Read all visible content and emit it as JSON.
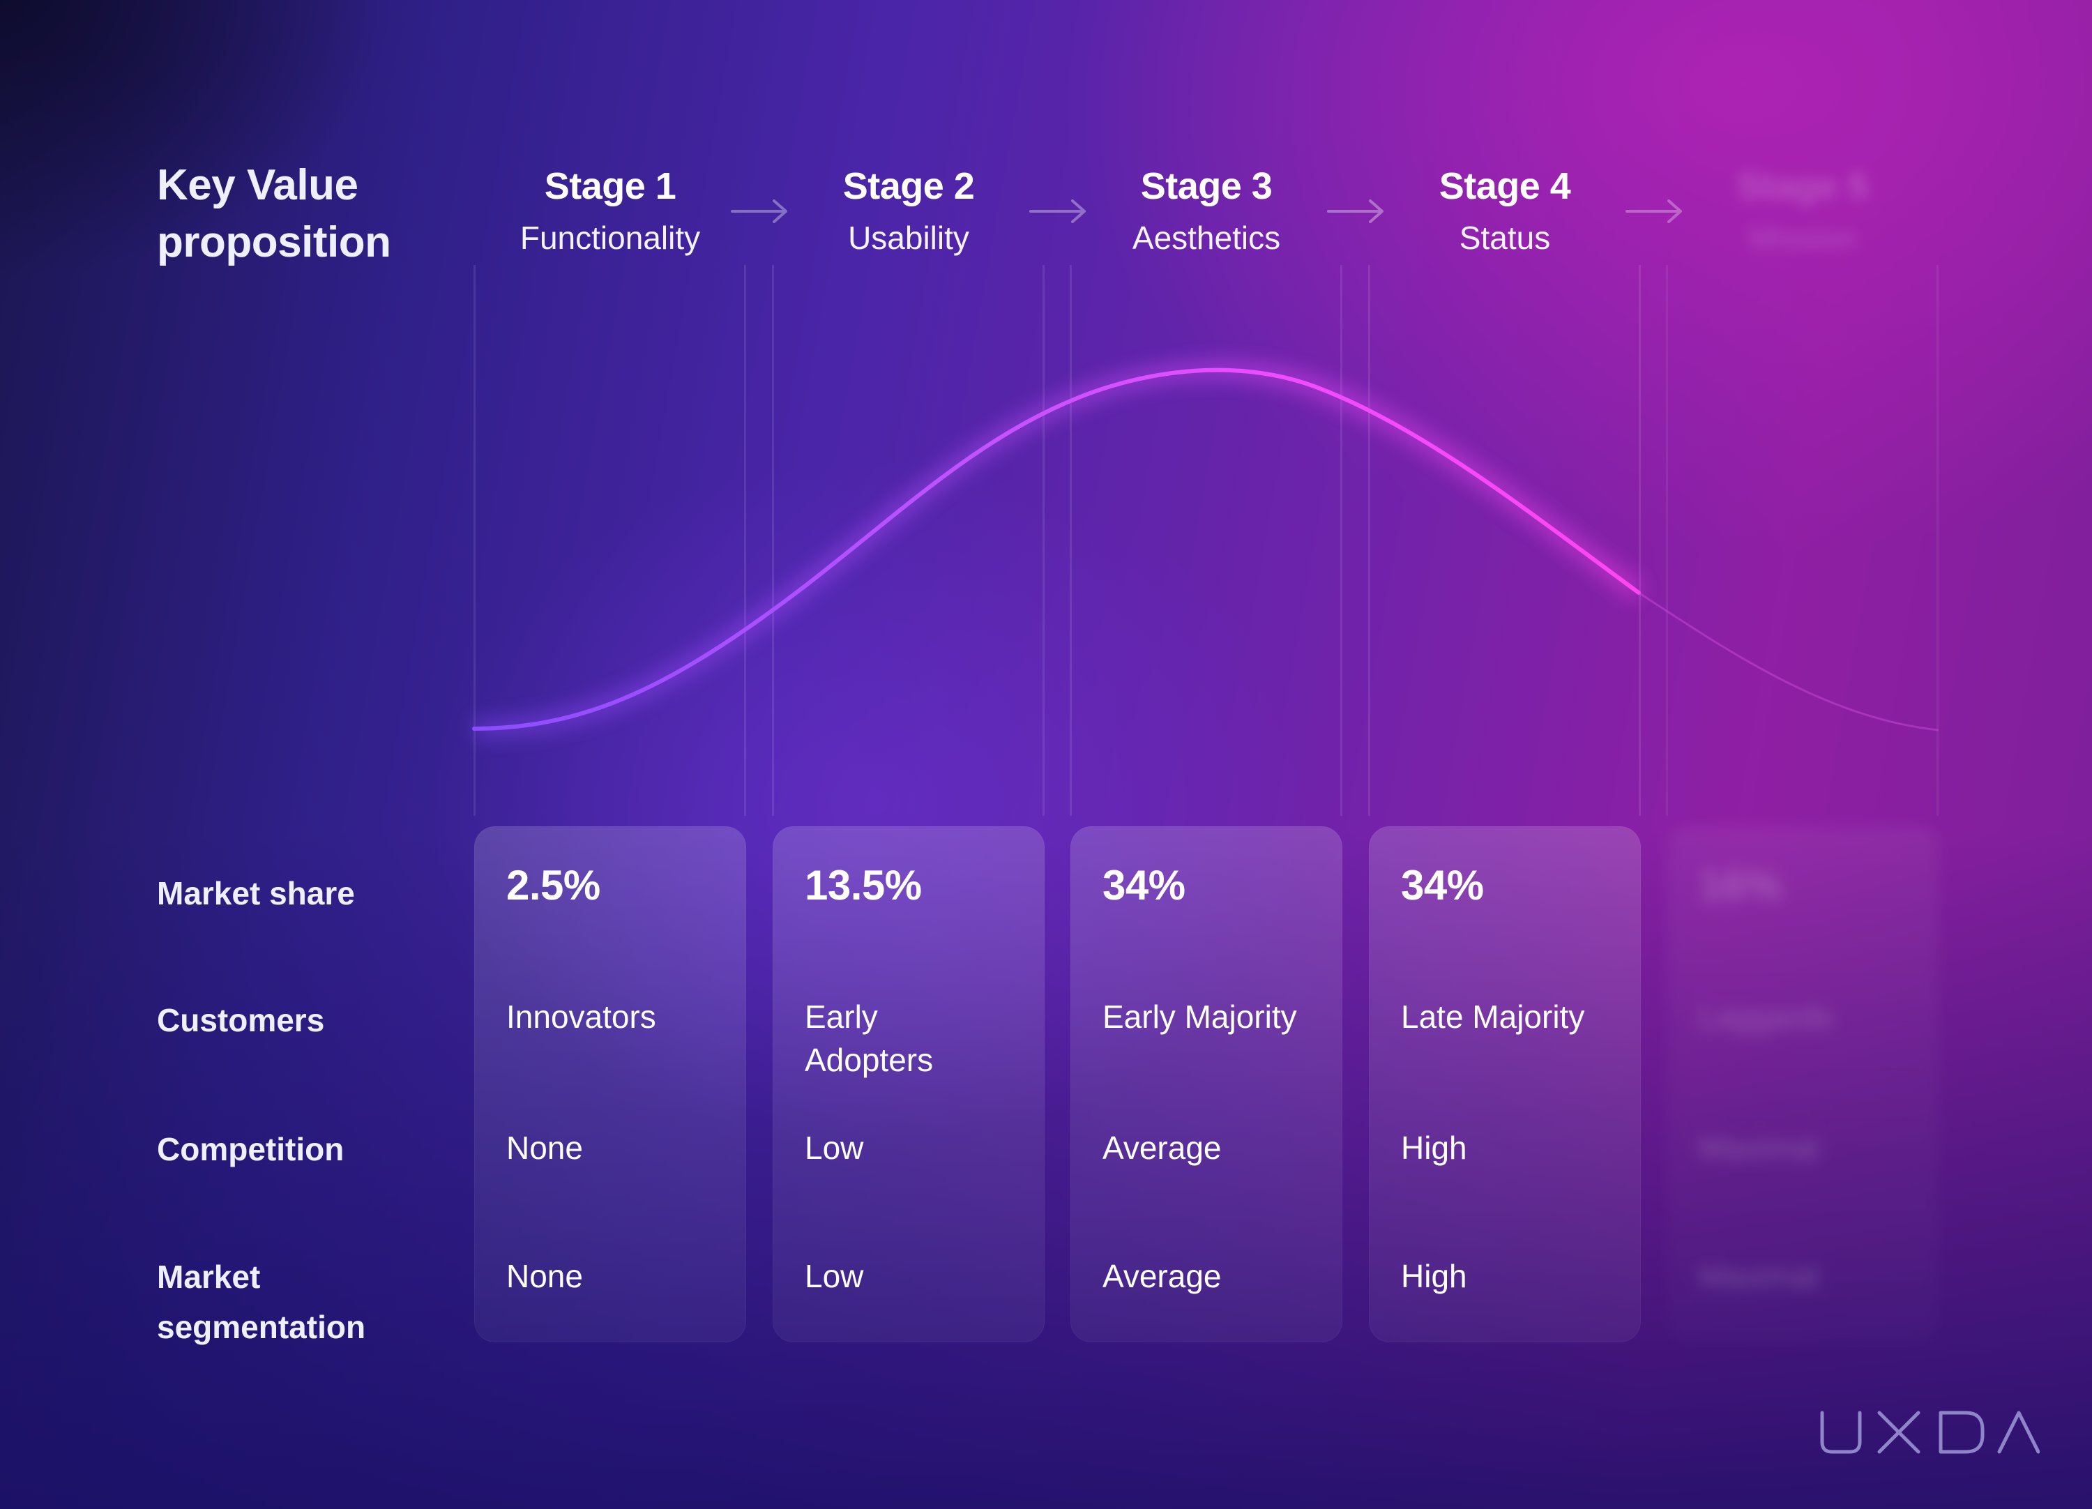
{
  "title": {
    "line1": "Key Value",
    "line2": "proposition"
  },
  "row_labels": {
    "market_share": "Market share",
    "customers": "Customers",
    "competition": "Competition",
    "market_segmentation_line1": "Market",
    "market_segmentation_line2": "segmentation"
  },
  "stages": [
    {
      "name": "Stage 1",
      "value_proposition": "Functionality",
      "market_share": "2.5%",
      "customers": "Innovators",
      "competition": "None",
      "market_segmentation": "None"
    },
    {
      "name": "Stage 2",
      "value_proposition": "Usability",
      "market_share": "13.5%",
      "customers": "Early Adopters",
      "competition": "Low",
      "market_segmentation": "Low"
    },
    {
      "name": "Stage 3",
      "value_proposition": "Aesthetics",
      "market_share": "34%",
      "customers": "Early Majority",
      "competition": "Average",
      "market_segmentation": "Average"
    },
    {
      "name": "Stage 4",
      "value_proposition": "Status",
      "market_share": "34%",
      "customers": "Late Majority",
      "competition": "High",
      "market_segmentation": "High"
    },
    {
      "name": "Stage 5",
      "value_proposition": "Mission",
      "market_share": "16%",
      "customers": "Laggards",
      "competition": "Maximal",
      "market_segmentation": "Maximal",
      "blurred": true
    }
  ],
  "curve": {
    "type": "bell-curve (diffusion of innovation)",
    "highlighted_until_stage": 4,
    "color_start": "#8a4dff",
    "color_peak": "#f04cff"
  },
  "icons": {
    "stage_arrow": "arrow-right-icon"
  },
  "brand": {
    "logo_text": "UXDA",
    "logo_color": "#8e86c8"
  }
}
